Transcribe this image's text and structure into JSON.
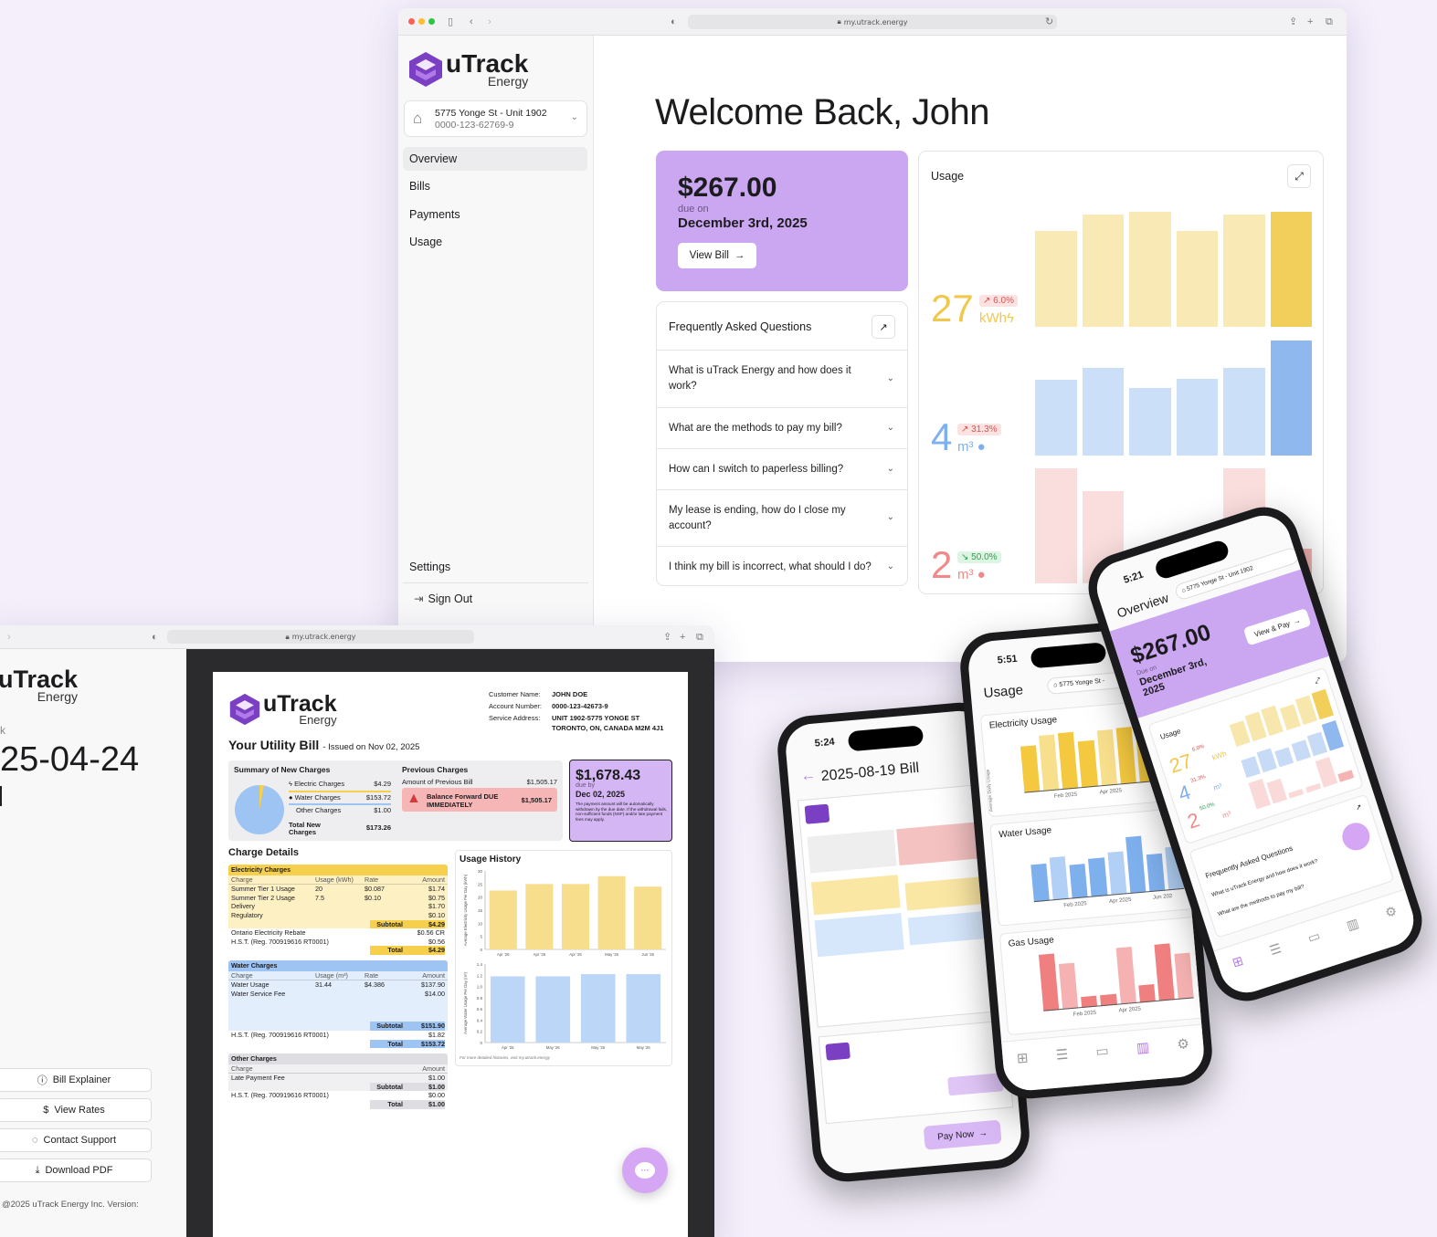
{
  "browser_main": {
    "url": "my.utrack.energy",
    "logo": {
      "name": "uTrack",
      "sub": "Energy"
    },
    "account": {
      "address": "5775 Yonge St - Unit 1902",
      "number": "0000-123-62769-9"
    },
    "nav": [
      "Overview",
      "Bills",
      "Payments",
      "Usage"
    ],
    "settings": "Settings",
    "sign_out": "Sign Out",
    "welcome": "Welcome Back, John",
    "bill_card": {
      "amount": "$267.00",
      "due_label": "due on",
      "due_date": "December 3rd, 2025",
      "button": "View Bill"
    },
    "faq": {
      "title": "Frequently Asked Questions",
      "items": [
        "What is uTrack Energy and how does it work?",
        "What are the methods to pay my bill?",
        "How can I switch to paperless billing?",
        "My lease is ending, how do I close my account?",
        "I think my bill is incorrect, what should I do?"
      ]
    },
    "usage": {
      "title": "Usage",
      "electricity": {
        "value": "27",
        "unit": "kWh",
        "change": "6.0%",
        "direction": "up",
        "color": "#f2cf5b",
        "bars": [
          0.83,
          0.98,
          1.0,
          0.83,
          0.98,
          1.0
        ]
      },
      "water": {
        "value": "4",
        "unit": "m³",
        "change": "31.3%",
        "direction": "up",
        "color": "#8fb8ef",
        "bars": [
          0.66,
          0.76,
          0.59,
          0.67,
          0.76,
          1.0
        ]
      },
      "gas": {
        "value": "2",
        "unit": "m³",
        "change": "50.0%",
        "direction": "down",
        "color": "#f5b3b3",
        "bars": [
          1.0,
          0.8,
          0.2,
          0.2,
          1.0,
          0.3
        ]
      }
    }
  },
  "browser_bill": {
    "url": "my.utrack.energy",
    "logo": {
      "name": "uTrack",
      "sub": "Energy"
    },
    "left_label": "k",
    "date": "25-04-24",
    "buttons": [
      "Bill Explainer",
      "View Rates",
      "Contact Support",
      "Download PDF"
    ],
    "footer": "@2025 uTrack Energy Inc. Version:",
    "bill": {
      "customer": [
        {
          "label": "Customer Name:",
          "value": "JOHN DOE"
        },
        {
          "label": "Account Number:",
          "value": "0000-123-42673-9"
        },
        {
          "label": "Service Address:",
          "value": "UNIT 1902-5775 YONGE ST"
        },
        {
          "label": "",
          "value": "TORONTO, ON, CANADA M2M 4J1"
        }
      ],
      "title": "Your Utility Bill",
      "issued": "- Issued on Nov 02, 2025",
      "summary_title": "Summary of New Charges",
      "summary": [
        {
          "label": "Electric Charges",
          "value": "$4.29"
        },
        {
          "label": "Water Charges",
          "value": "$153.72"
        },
        {
          "label": "Other Charges",
          "value": "$1.00"
        }
      ],
      "total_label": "Total New Charges",
      "total_value": "$173.26",
      "prev_title": "Previous Charges",
      "prev_label": "Amount of Previous Bill",
      "prev_value": "$1,505.17",
      "balance_label": "Balance Forward DUE IMMEDIATELY",
      "balance_value": "$1,505.17",
      "due_amount": "$1,678.43",
      "due_by": "due by",
      "due_date": "Dec 02, 2025",
      "due_note": "The payment amount will be automatically withdrawn by the due date. If the withdrawal fails, non-sufficient funds (NSF) and/or late payment fees may apply.",
      "charge_details": "Charge Details",
      "electric": {
        "title": "Electricity Charges",
        "head": [
          "Charge",
          "Usage (kWh)",
          "Rate",
          "Amount"
        ],
        "rows": [
          [
            "Summer Tier 1 Usage",
            "20",
            "$0.087",
            "$1.74"
          ],
          [
            "Summer Tier 2 Usage",
            "7.5",
            "$0.10",
            "$0.75"
          ],
          [
            "Delivery",
            "",
            "",
            "$1.70"
          ],
          [
            "Regulatory",
            "",
            "",
            "$0.10"
          ]
        ],
        "subtotal": "$4.29",
        "extra": [
          [
            "Ontario Electricity Rebate",
            "$0.56 CR"
          ],
          [
            "H.S.T. (Reg. 700919616 RT0001)",
            "$0.56"
          ]
        ],
        "total": "$4.29"
      },
      "water": {
        "title": "Water Charges",
        "head": [
          "Charge",
          "Usage (m³)",
          "Rate",
          "Amount"
        ],
        "rows": [
          [
            "Water Usage",
            "31.44",
            "$4.386",
            "$137.90"
          ],
          [
            "Water Service Fee",
            "",
            "",
            "$14.00"
          ]
        ],
        "subtotal": "$151.90",
        "extra": [
          [
            "H.S.T. (Reg. 700919616 RT0001)",
            "$1.82"
          ]
        ],
        "total": "$153.72"
      },
      "other": {
        "title": "Other Charges",
        "head": [
          "Charge",
          "Amount"
        ],
        "rows": [
          [
            "Late Payment Fee",
            "$1.00"
          ]
        ],
        "subtotal": "$1.00",
        "extra": [
          [
            "H.S.T. (Reg. 700919616 RT0001)",
            "$0.00"
          ]
        ],
        "total": "$1.00"
      },
      "subtotal_label": "Subtotal",
      "total_word": "Total",
      "history_title": "Usage History",
      "history_note": "For more detailed histories, visit my.utrack.energy",
      "elec_chart": {
        "ylabel": "Average Electricity Usage Per Day (kWh)",
        "ticks": [
          "30",
          "25",
          "20",
          "15",
          "10",
          "5",
          "0"
        ],
        "x": [
          "Apr '26",
          "Apr '26",
          "Apr '26",
          "May '26",
          "Jun '26"
        ],
        "values": [
          22.5,
          25,
          25,
          28,
          24
        ]
      },
      "water_chart": {
        "ylabel": "Average Water Usage Per Day (m³)",
        "ticks": [
          "1.4",
          "1.2",
          "1.0",
          "0.8",
          "0.6",
          "0.4",
          "0.2",
          "0"
        ],
        "x": [
          "Apr '26",
          "May '26",
          "May '26",
          "May '26"
        ],
        "values": [
          1.18,
          1.18,
          1.22,
          1.22
        ]
      }
    }
  },
  "phone1": {
    "time": "5:24",
    "title": "2025-08-19 Bill",
    "pay": "Pay Now"
  },
  "phone2": {
    "time": "5:51",
    "title": "Usage",
    "account": "5775 Yonge St -",
    "sections": [
      "Electricity Usage",
      "Water Usage",
      "Gas Usage"
    ],
    "xlabels": [
      "Feb 2025",
      "Apr 2025",
      "Jun 202"
    ],
    "ylabel": "Average Daily Usage"
  },
  "phone3": {
    "time": "5:21",
    "title": "Overview",
    "account": "5775 Yonge St - Unit 1902",
    "amount": "$267.00",
    "due_label": "Due on",
    "due_date": "December 3rd, 2025",
    "button": "View & Pay",
    "usage_title": "Usage",
    "elec": "27",
    "elec_unit": "kWh",
    "elec_change": "6.0%",
    "water": "4",
    "water_unit": "m³",
    "water_change": "31.3%",
    "gas": "2",
    "gas_unit": "m³",
    "gas_change": "50.0%",
    "faq_title": "Frequently Asked Questions",
    "faq": [
      "What is uTrack Energy and how does it work?",
      "What are the methods to pay my bill?"
    ]
  }
}
